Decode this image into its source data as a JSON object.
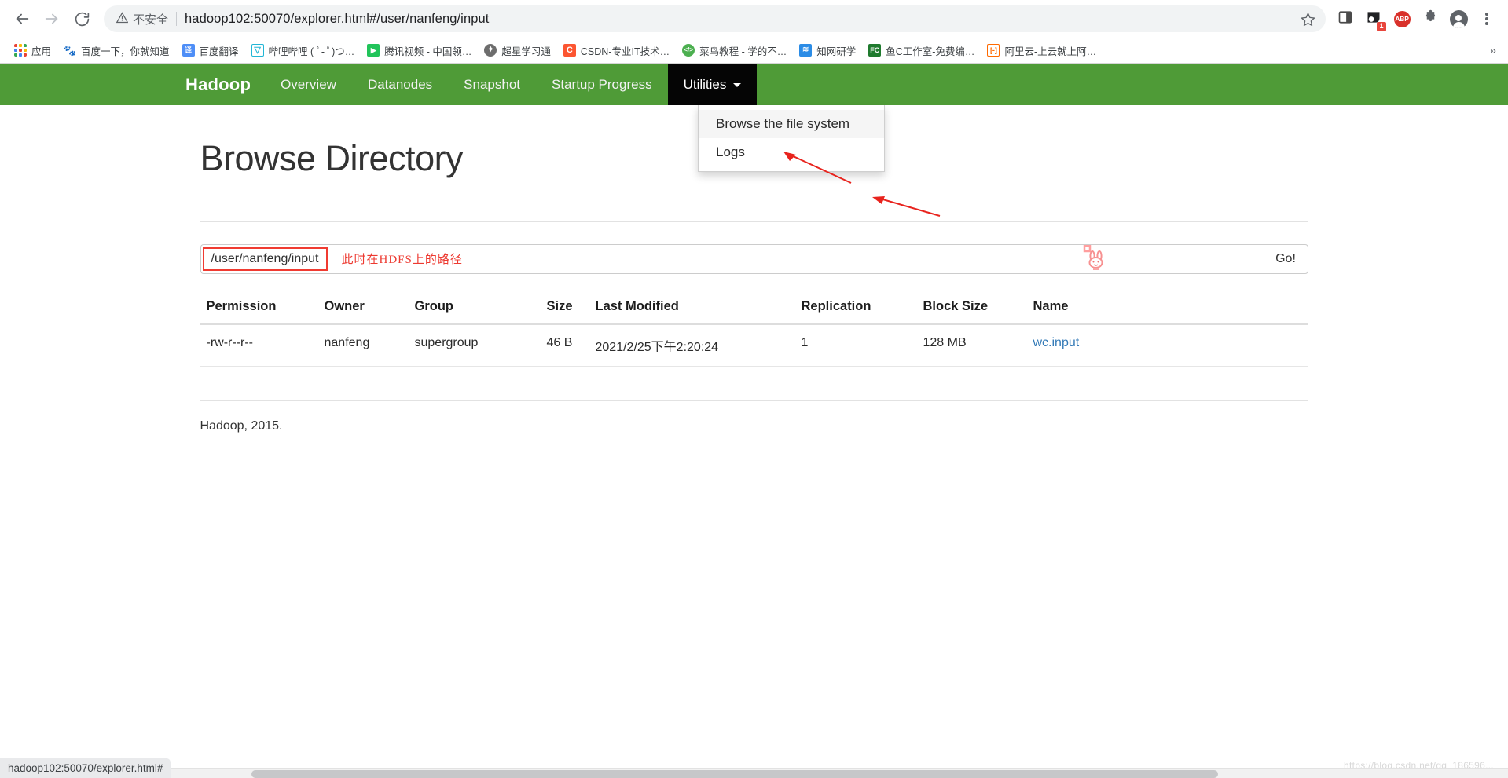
{
  "browser": {
    "back_icon": "back-arrow-icon",
    "forward_icon": "forward-arrow-icon",
    "reload_icon": "reload-icon",
    "security_label": "不安全",
    "url": "hadoop102:50070/explorer.html#/user/nanfeng/input",
    "bookmark_star_icon": "star-icon",
    "extension_badge_count": "1",
    "abp_label": "ABP",
    "overflow_label": "»",
    "status_bar_text": "hadoop102:50070/explorer.html#"
  },
  "bookmarks": [
    {
      "label": "应用",
      "icon": "apps-grid-icon",
      "color": "#4285f4"
    },
    {
      "label": "百度一下，你就知道",
      "icon": "baidu-icon",
      "color": "#2932e1"
    },
    {
      "label": "百度翻译",
      "icon": "baidu-translate-icon",
      "color": "#4e8ef7"
    },
    {
      "label": "哔哩哔哩 ( ﾟ- ﾟ)つ…",
      "icon": "bilibili-icon",
      "color": "#24b8dd"
    },
    {
      "label": "腾讯视频 - 中国领…",
      "icon": "tencent-video-icon",
      "color": "#21c45a"
    },
    {
      "label": "超星学习通",
      "icon": "chaoxing-icon",
      "color": "#565656"
    },
    {
      "label": "CSDN-专业IT技术…",
      "icon": "csdn-icon",
      "color": "#fc5531"
    },
    {
      "label": "菜鸟教程 - 学的不…",
      "icon": "runoob-icon",
      "color": "#4caf50"
    },
    {
      "label": "知网研学",
      "icon": "cnki-icon",
      "color": "#2b8ce6"
    },
    {
      "label": "鱼C工作室-免费编…",
      "icon": "fishc-icon",
      "color": "#1f7a2e"
    },
    {
      "label": "阿里云-上云就上阿…",
      "icon": "aliyun-icon",
      "color": "#ff6a00"
    }
  ],
  "navbar": {
    "brand": "Hadoop",
    "items": [
      {
        "label": "Overview",
        "active": false
      },
      {
        "label": "Datanodes",
        "active": false
      },
      {
        "label": "Snapshot",
        "active": false
      },
      {
        "label": "Startup Progress",
        "active": false
      },
      {
        "label": "Utilities",
        "active": true,
        "caret": true
      }
    ],
    "brand_bg": "#4f9b37",
    "active_bg": "#050505"
  },
  "dropdown": {
    "items": [
      {
        "label": "Browse the file system",
        "hover": true
      },
      {
        "label": "Logs",
        "hover": false
      }
    ]
  },
  "main": {
    "title": "Browse Directory",
    "path_value": "/user/nanfeng/input",
    "path_note": "此时在HDFS上的路径",
    "go_label": "Go!",
    "table": {
      "headers": [
        "Permission",
        "Owner",
        "Group",
        "Size",
        "Last Modified",
        "Replication",
        "Block Size",
        "Name"
      ],
      "rows": [
        {
          "permission": "-rw-r--r--",
          "owner": "nanfeng",
          "group": "supergroup",
          "size": "46 B",
          "last_modified": "2021/2/25下午2:20:24",
          "replication": "1",
          "block_size": "128 MB",
          "name": "wc.input"
        }
      ]
    },
    "footer": "Hadoop, 2015."
  },
  "watermarks": {
    "blog": "https://blog.csdn.net/qq_186596...",
    "bunny_icon": "bunny-sticker-icon"
  },
  "colors": {
    "accent_green": "#4f9b37",
    "annotation_red": "#ed3a31",
    "link_blue": "#337ab7"
  }
}
